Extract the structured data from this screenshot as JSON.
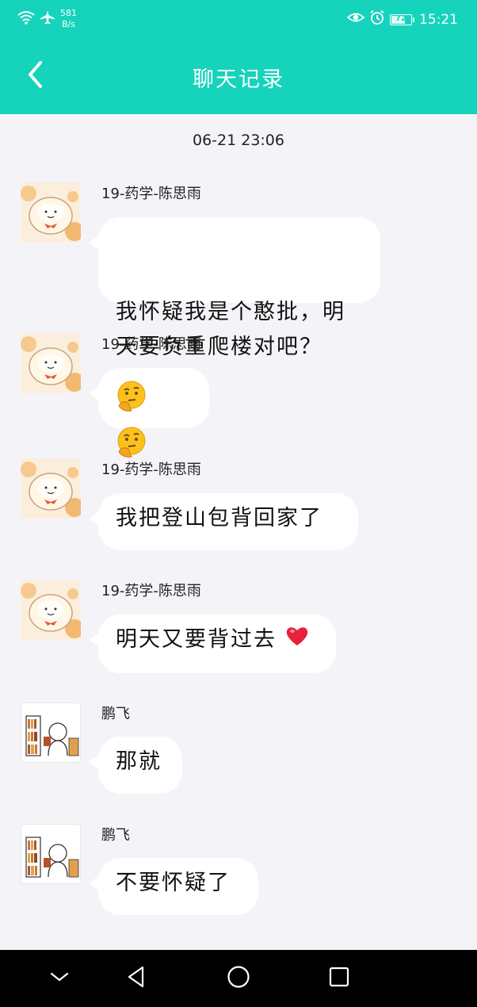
{
  "status_bar": {
    "net_speed_value": "581",
    "net_speed_unit": "B/s",
    "battery": "72",
    "battery_level": 0.72,
    "time": "15:21",
    "icons": [
      "wifi-icon",
      "airplane-icon",
      "eye-comfort-icon",
      "alarm-icon",
      "battery-icon"
    ]
  },
  "header": {
    "title": "聊天记录",
    "back_icon": "chevron-left-icon"
  },
  "date_label": "06-21 23:06",
  "messages": [
    {
      "sender": "19-药学-陈思雨",
      "text": "我怀疑我是个憨批，明\n天要负重爬楼对吧？",
      "avatar": "cartoon-sheep-avatar"
    },
    {
      "sender": "19-药学-陈思雨",
      "emoji": [
        "thinking-face-emoji",
        "thinking-face-emoji"
      ],
      "avatar": "cartoon-sheep-avatar"
    },
    {
      "sender": "19-药学-陈思雨",
      "text": "我把登山包背回家了",
      "avatar": "cartoon-sheep-avatar"
    },
    {
      "sender": "19-药学-陈思雨",
      "text": "明天又要背过去",
      "emoji": [
        "red-heart-emoji"
      ],
      "avatar": "cartoon-sheep-avatar"
    },
    {
      "sender": "鹏飞",
      "text": "那就",
      "avatar": "bookshelf-figure-avatar"
    },
    {
      "sender": "鹏飞",
      "text": "不要怀疑了",
      "avatar": "bookshelf-figure-avatar"
    }
  ],
  "nav_bar": {
    "buttons": [
      "collapse-icon",
      "back-triangle-icon",
      "home-circle-icon",
      "recents-square-icon"
    ]
  },
  "colors": {
    "accent": "#16d3bc",
    "background": "#f4f4f8",
    "bubble": "#ffffff",
    "nav_bar": "#000000"
  }
}
